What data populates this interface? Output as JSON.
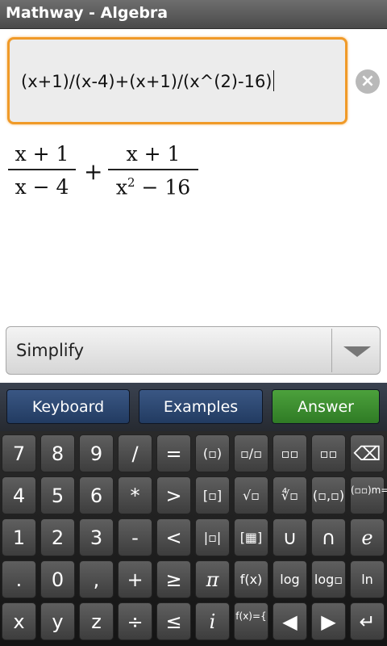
{
  "app": {
    "title": "Mathway - Algebra"
  },
  "input": {
    "value": "(x+1)/(x-4)+(x+1)/(x^(2)-16)"
  },
  "preview": {
    "fraction1": {
      "numerator": "x + 1",
      "denominator": "x − 4"
    },
    "operator": "+",
    "fraction2": {
      "numerator": "x + 1",
      "denominator_base": "x",
      "denominator_exponent": "2",
      "denominator_rest": " − 16"
    }
  },
  "action": {
    "selected": "Simplify"
  },
  "tabs": [
    "Keyboard",
    "Examples",
    "Answer"
  ],
  "keyboard": {
    "rows": [
      [
        "7",
        "8",
        "9",
        "/",
        "=",
        "(▫)",
        "▫/▫",
        "▫▫",
        "▫▫",
        "⌫"
      ],
      [
        "4",
        "5",
        "6",
        "*",
        ">",
        "[▫]",
        "√▫",
        "∜▫",
        "(▫,▫)",
        "(▫▫)m="
      ],
      [
        "1",
        "2",
        "3",
        "-",
        "<",
        "|▫|",
        "[▦]",
        "∪",
        "∩",
        "e"
      ],
      [
        ".",
        "0",
        ",",
        "+",
        "≥",
        "π",
        "f(x)",
        "log",
        "log▫",
        "ln"
      ],
      [
        "x",
        "y",
        "z",
        "÷",
        "≤",
        "i",
        "f(x)={",
        "◀",
        "▶",
        "↵"
      ]
    ]
  }
}
